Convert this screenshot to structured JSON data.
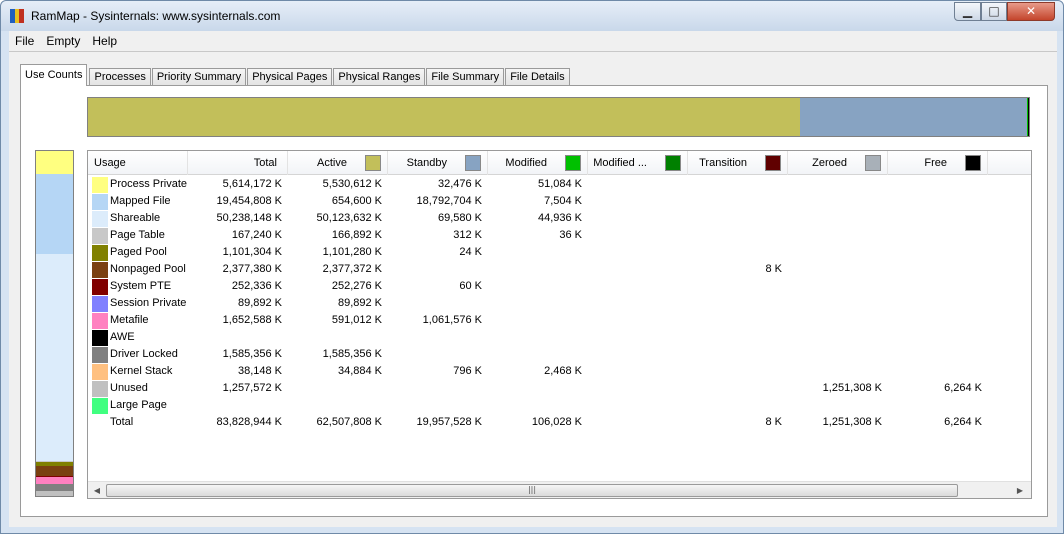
{
  "window": {
    "title": "RamMap - Sysinternals: www.sysinternals.com",
    "min_glyph": "▁",
    "max_glyph": "□",
    "close_glyph": "✕",
    "icon_colors": [
      "#1f5fbf",
      "#e8c020",
      "#c03020"
    ]
  },
  "menu": {
    "items": [
      "File",
      "Empty",
      "Help"
    ]
  },
  "tabs": [
    "Use Counts",
    "Processes",
    "Priority Summary",
    "Physical Pages",
    "Physical Ranges",
    "File Summary",
    "File Details"
  ],
  "active_tab": "Use Counts",
  "summary_bar": {
    "segments": [
      {
        "label": "Active",
        "color": "#c2bf5a",
        "value": 62507808
      },
      {
        "label": "Standby",
        "color": "#87a3c2",
        "value": 19957528
      },
      {
        "label": "Modified",
        "color": "#00c000",
        "value": 106028
      },
      {
        "label": "Free",
        "color": "#000000",
        "value": 6264
      }
    ]
  },
  "usage_bar": {
    "segments": [
      {
        "label": "Process Private",
        "color": "#ffff80",
        "value": 5614172
      },
      {
        "label": "Mapped File",
        "color": "#b5d6f5",
        "value": 19454808
      },
      {
        "label": "Shareable",
        "color": "#dcecfb",
        "value": 50238148
      },
      {
        "label": "Page Table",
        "color": "#c8c8c8",
        "value": 167240
      },
      {
        "label": "Paged Pool",
        "color": "#808000",
        "value": 1101304
      },
      {
        "label": "Nonpaged Pool",
        "color": "#7a4010",
        "value": 2377380
      },
      {
        "label": "System PTE",
        "color": "#800000",
        "value": 252336
      },
      {
        "label": "Session Private",
        "color": "#8080ff",
        "value": 89892
      },
      {
        "label": "Metafile",
        "color": "#ff80c0",
        "value": 1652588
      },
      {
        "label": "AWE",
        "color": "#000000",
        "value": 0
      },
      {
        "label": "Driver Locked",
        "color": "#808080",
        "value": 1585356
      },
      {
        "label": "Kernel Stack",
        "color": "#ffc080",
        "value": 38148
      },
      {
        "label": "Unused",
        "color": "#c0c0c0",
        "value": 1257572
      },
      {
        "label": "Large Page",
        "color": "#40ff80",
        "value": 0
      }
    ]
  },
  "table": {
    "columns": [
      {
        "label": "Usage",
        "swatch": ""
      },
      {
        "label": "Total",
        "swatch": ""
      },
      {
        "label": "Active",
        "swatch": "#c2bf5a"
      },
      {
        "label": "Standby",
        "swatch": "#87a3c2"
      },
      {
        "label": "Modified",
        "swatch": "#00c000"
      },
      {
        "label": "Modified ...",
        "swatch": "#008000"
      },
      {
        "label": "Transition",
        "swatch": "#600000"
      },
      {
        "label": "Zeroed",
        "swatch": "#a8b0b8"
      },
      {
        "label": "Free",
        "swatch": "#000000"
      }
    ],
    "rows": [
      {
        "color": "#ffff80",
        "cells": [
          "Process Private",
          "5,614,172 K",
          "5,530,612 K",
          "32,476 K",
          "51,084 K",
          "",
          "",
          "",
          ""
        ]
      },
      {
        "color": "#b5d6f5",
        "cells": [
          "Mapped File",
          "19,454,808 K",
          "654,600 K",
          "18,792,704 K",
          "7,504 K",
          "",
          "",
          "",
          ""
        ]
      },
      {
        "color": "#dcecfb",
        "cells": [
          "Shareable",
          "50,238,148 K",
          "50,123,632 K",
          "69,580 K",
          "44,936 K",
          "",
          "",
          "",
          ""
        ]
      },
      {
        "color": "#c8c8c8",
        "cells": [
          "Page Table",
          "167,240 K",
          "166,892 K",
          "312 K",
          "36 K",
          "",
          "",
          "",
          ""
        ]
      },
      {
        "color": "#808000",
        "cells": [
          "Paged Pool",
          "1,101,304 K",
          "1,101,280 K",
          "24 K",
          "",
          "",
          "",
          "",
          ""
        ]
      },
      {
        "color": "#7a4010",
        "cells": [
          "Nonpaged Pool",
          "2,377,380 K",
          "2,377,372 K",
          "",
          "",
          "",
          "8 K",
          "",
          ""
        ]
      },
      {
        "color": "#800000",
        "cells": [
          "System PTE",
          "252,336 K",
          "252,276 K",
          "60 K",
          "",
          "",
          "",
          "",
          ""
        ]
      },
      {
        "color": "#8080ff",
        "cells": [
          "Session Private",
          "89,892 K",
          "89,892 K",
          "",
          "",
          "",
          "",
          "",
          ""
        ]
      },
      {
        "color": "#ff80c0",
        "cells": [
          "Metafile",
          "1,652,588 K",
          "591,012 K",
          "1,061,576 K",
          "",
          "",
          "",
          "",
          ""
        ]
      },
      {
        "color": "#000000",
        "cells": [
          "AWE",
          "",
          "",
          "",
          "",
          "",
          "",
          "",
          ""
        ]
      },
      {
        "color": "#808080",
        "cells": [
          "Driver Locked",
          "1,585,356 K",
          "1,585,356 K",
          "",
          "",
          "",
          "",
          "",
          ""
        ]
      },
      {
        "color": "#ffc080",
        "cells": [
          "Kernel Stack",
          "38,148 K",
          "34,884 K",
          "796 K",
          "2,468 K",
          "",
          "",
          "",
          ""
        ]
      },
      {
        "color": "#c0c0c0",
        "cells": [
          "Unused",
          "1,257,572 K",
          "",
          "",
          "",
          "",
          "",
          "1,251,308 K",
          "6,264 K"
        ]
      },
      {
        "color": "#40ff80",
        "cells": [
          "Large Page",
          "",
          "",
          "",
          "",
          "",
          "",
          "",
          ""
        ]
      },
      {
        "color": "",
        "cells": [
          "Total",
          "83,828,944 K",
          "62,507,808 K",
          "19,957,528 K",
          "106,028 K",
          "",
          "8 K",
          "1,251,308 K",
          "6,264 K"
        ]
      }
    ]
  },
  "scrollbar": {
    "left_glyph": "◀",
    "right_glyph": "▶",
    "grip_glyph": "|||"
  }
}
